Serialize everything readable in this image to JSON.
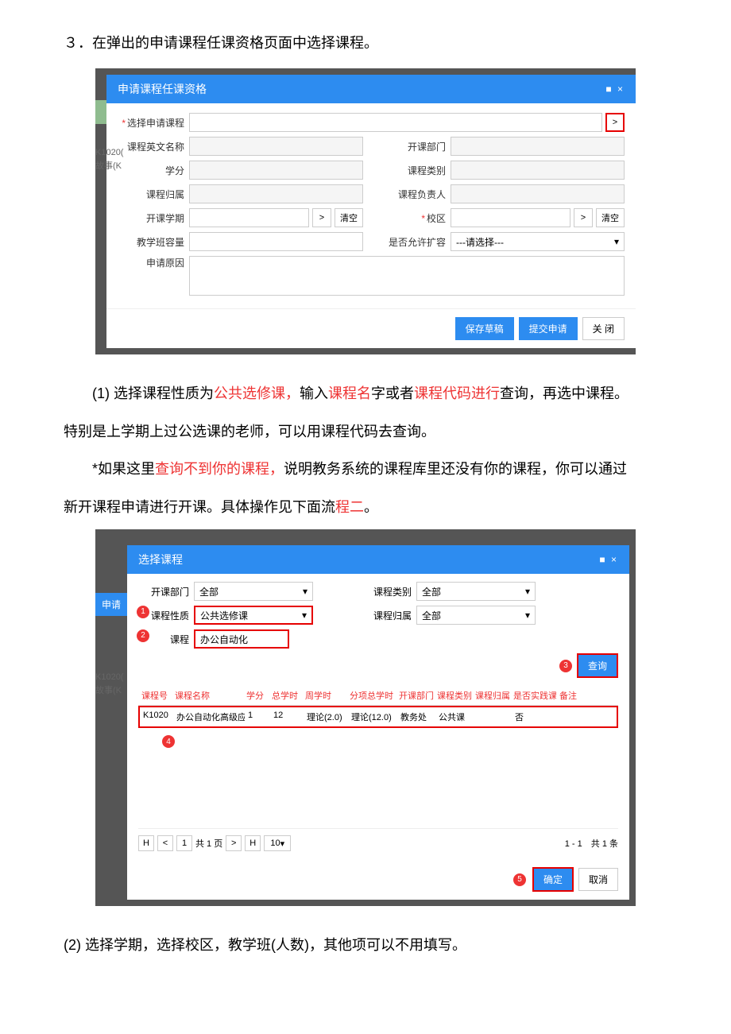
{
  "step_title": "３．在弹出的申请课程任课资格页面中选择课程。",
  "modal1": {
    "title": "申请课程任课资格",
    "fields": {
      "select_course": "选择申请课程",
      "en_name": "课程英文名称",
      "credit": "学分",
      "belong": "课程归属",
      "term": "开课学期",
      "capacity": "教学班容量",
      "reason": "申请原因",
      "dept": "开课部门",
      "category": "课程类别",
      "owner": "课程负责人",
      "campus": "校区",
      "allow_expand": "是否允许扩容",
      "expand_placeholder": "---请选择---",
      "browse": ">",
      "clear": "清空"
    },
    "buttons": {
      "save": "保存草稿",
      "submit": "提交申请",
      "close": "关 闭"
    }
  },
  "para1_a": "(1) 选择课程性质为",
  "para1_b": "公共选修课，",
  "para1_c": "输入",
  "para1_d": "课程名",
  "para1_e": "字或者",
  "para1_f": "课程代码进行",
  "para1_g": "查询，再选中课程。",
  "para2": "特别是上学期上过公选课的老师，可以用课程代码去查询。",
  "para3_a": "*如果这里",
  "para3_b": "查询不到你的课程，",
  "para3_c": "说明教务系统的课程库里还没有你的课程，你可以通过",
  "para4_a": "新开课程申请进行开课。具体操作见下面流",
  "para4_b": "程二",
  "para4_c": "。",
  "modal2": {
    "title": "选择课程",
    "side_label": "申请",
    "filters": {
      "dept": "开课部门",
      "dept_val": "全部",
      "category": "课程类别",
      "cat_val": "全部",
      "nature": "课程性质",
      "nature_val": "公共选修课",
      "belong": "课程归属",
      "belong_val": "全部",
      "course": "课程",
      "course_val": "办公自动化"
    },
    "query_btn": "查询",
    "headers": [
      "课程号",
      "课程名称",
      "学分",
      "总学时",
      "周学时",
      "分项总学时",
      "开课部门",
      "课程类别",
      "课程归属",
      "是否实践课",
      "备注"
    ],
    "row": [
      "K1020",
      "办公自动化高级应用",
      "1",
      "12",
      "理论(2.0)",
      "理论(12.0)",
      "教务处",
      "公共课",
      "",
      "否",
      ""
    ],
    "page": {
      "first": "H",
      "prev": "<",
      "cur": "1",
      "total": "共 1 页",
      "next": ">",
      "last": "H",
      "size": "10",
      "info": "1 - 1　共 1 条"
    },
    "ok": "确定",
    "cancel": "取消"
  },
  "para5": "(2) 选择学期，选择校区，教学班(人数)，其他项可以不用填写。",
  "badges": {
    "b1": "1",
    "b2": "2",
    "b3": "3",
    "b4": "4",
    "b5": "5"
  }
}
